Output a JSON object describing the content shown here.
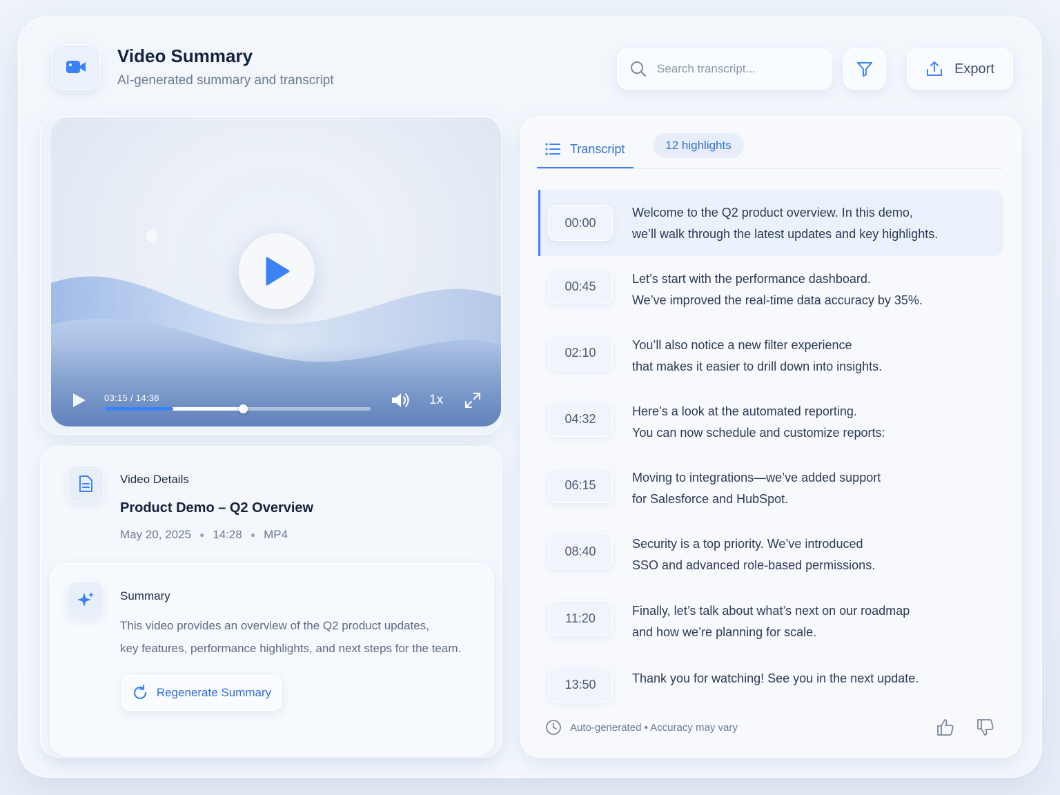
{
  "header": {
    "title": "Video Summary",
    "subtitle": "AI-generated summary and transcript",
    "search_placeholder": "Search transcript...",
    "export_label": "Export"
  },
  "player": {
    "time": "03:15 / 14:38",
    "progress": 0.26,
    "buffered": 0.52,
    "speed": "1x"
  },
  "details": {
    "label": "Video Details",
    "title": "Product Demo – Q2 Overview",
    "date": "May 20, 2025",
    "duration": "14:28",
    "format": "MP4"
  },
  "summary": {
    "label": "Summary",
    "line1": "This video provides an overview of the Q2 product updates,",
    "line2": "key features, performance highlights, and next steps for the team.",
    "regenerate_label": "Regenerate Summary"
  },
  "tabs": {
    "transcript": "Transcript",
    "highlights": "12 highlights"
  },
  "transcript": [
    {
      "time": "00:00",
      "line1": "Welcome to the Q2 product overview. In this demo,",
      "line2": "we’ll walk through the latest updates and key highlights."
    },
    {
      "time": "00:45",
      "line1": "Let’s start with the performance dashboard.",
      "line2": "We’ve improved the real-time data accuracy by 35%."
    },
    {
      "time": "02:10",
      "line1": "You’ll also notice a new filter experience",
      "line2": "that makes it easier to drill down into insights."
    },
    {
      "time": "04:32",
      "line1": "Here’s a look at the automated reporting.",
      "line2": "You can now schedule and customize reports:"
    },
    {
      "time": "06:15",
      "line1": "Moving to integrations—we’ve added support",
      "line2": "for Salesforce and HubSpot."
    },
    {
      "time": "08:40",
      "line1": "Security is a top priority. We’ve introduced",
      "line2": "SSO and advanced role-based permissions."
    },
    {
      "time": "11:20",
      "line1": "Finally, let’s talk about what’s next on our roadmap",
      "line2": "and how we’re planning for scale."
    },
    {
      "time": "13:50",
      "line1": "Thank you for watching! See you in the next update.",
      "line2": ""
    }
  ],
  "footer": {
    "note": "Auto-generated • Accuracy may vary"
  },
  "colors": {
    "accent": "#3b82f6",
    "accent_text": "#2f6fd6",
    "background": "#f3f7fc"
  }
}
